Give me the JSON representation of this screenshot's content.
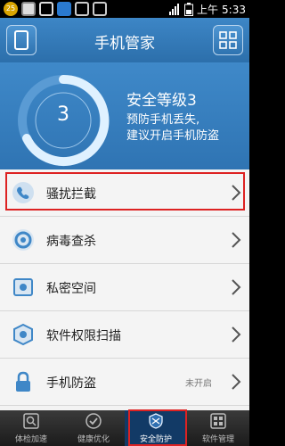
{
  "status_bar": {
    "time_prefix": "上午",
    "time": "5:33",
    "badge_count": "25"
  },
  "header": {
    "title": "手机管家"
  },
  "hero": {
    "score": "3",
    "level": "安全等级3",
    "desc_line1": "预防手机丢失,",
    "desc_line2": "建议开启手机防盗"
  },
  "list": {
    "items": [
      {
        "label": "骚扰拦截",
        "status": ""
      },
      {
        "label": "病毒查杀",
        "status": ""
      },
      {
        "label": "私密空间",
        "status": ""
      },
      {
        "label": "软件权限扫描",
        "status": ""
      },
      {
        "label": "手机防盗",
        "status": "未开启"
      }
    ]
  },
  "tabs": [
    {
      "label": "体检加速"
    },
    {
      "label": "健康优化"
    },
    {
      "label": "安全防护"
    },
    {
      "label": "软件管理"
    }
  ],
  "colors": {
    "header_blue": "#3a82c4",
    "highlight_red": "#dd2222"
  }
}
